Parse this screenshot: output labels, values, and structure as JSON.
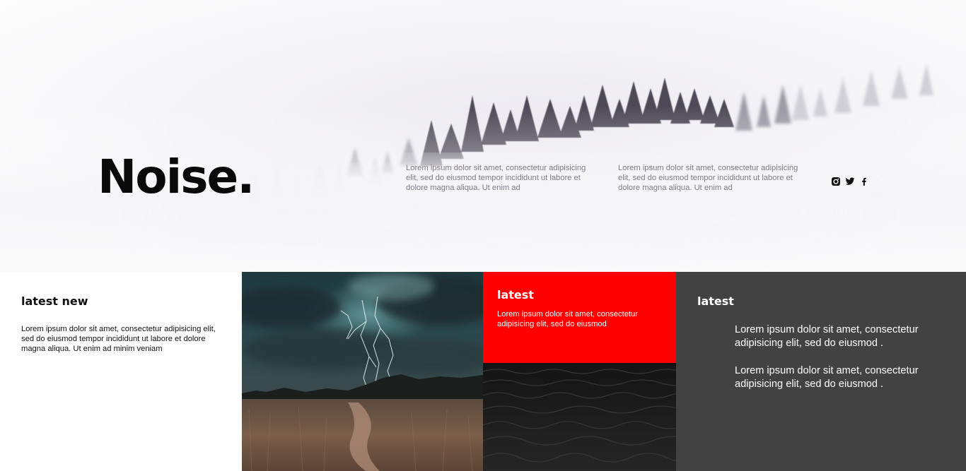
{
  "hero": {
    "brand": "Noise.",
    "text_one": "Lorem ipsum dolor sit amet, consectetur adipisicing elit, sed do eiusmod tempor incididunt ut labore et dolore magna aliqua. Ut enim ad",
    "text_two": "Lorem ipsum dolor sit amet, consectetur adipisicing elit, sed do eiusmod tempor incididunt ut labore et dolore magna aliqua. Ut enim ad",
    "social_icons": [
      "instagram-icon",
      "twitter-icon",
      "facebook-icon"
    ]
  },
  "news": {
    "title": "latest new",
    "body": "Lorem ipsum dolor sit amet, consectetur adipisicing elit, sed do eiusmod tempor incididunt ut labore et dolore magna aliqua. Ut enim ad minim veniam"
  },
  "red_card": {
    "title": "latest",
    "body": "Lorem ipsum dolor sit amet, consectetur adipisicing elit, sed do eiusmod"
  },
  "dark_card": {
    "title": "latest",
    "items": [
      "Lorem ipsum dolor sit amet, consectetur adipisicing elit, sed do eiusmod .",
      "Lorem ipsum dolor sit amet, consectetur adipisicing elit, sed do eiusmod ."
    ]
  },
  "colors": {
    "accent_red": "#ff0000",
    "dark_panel": "#424242"
  }
}
